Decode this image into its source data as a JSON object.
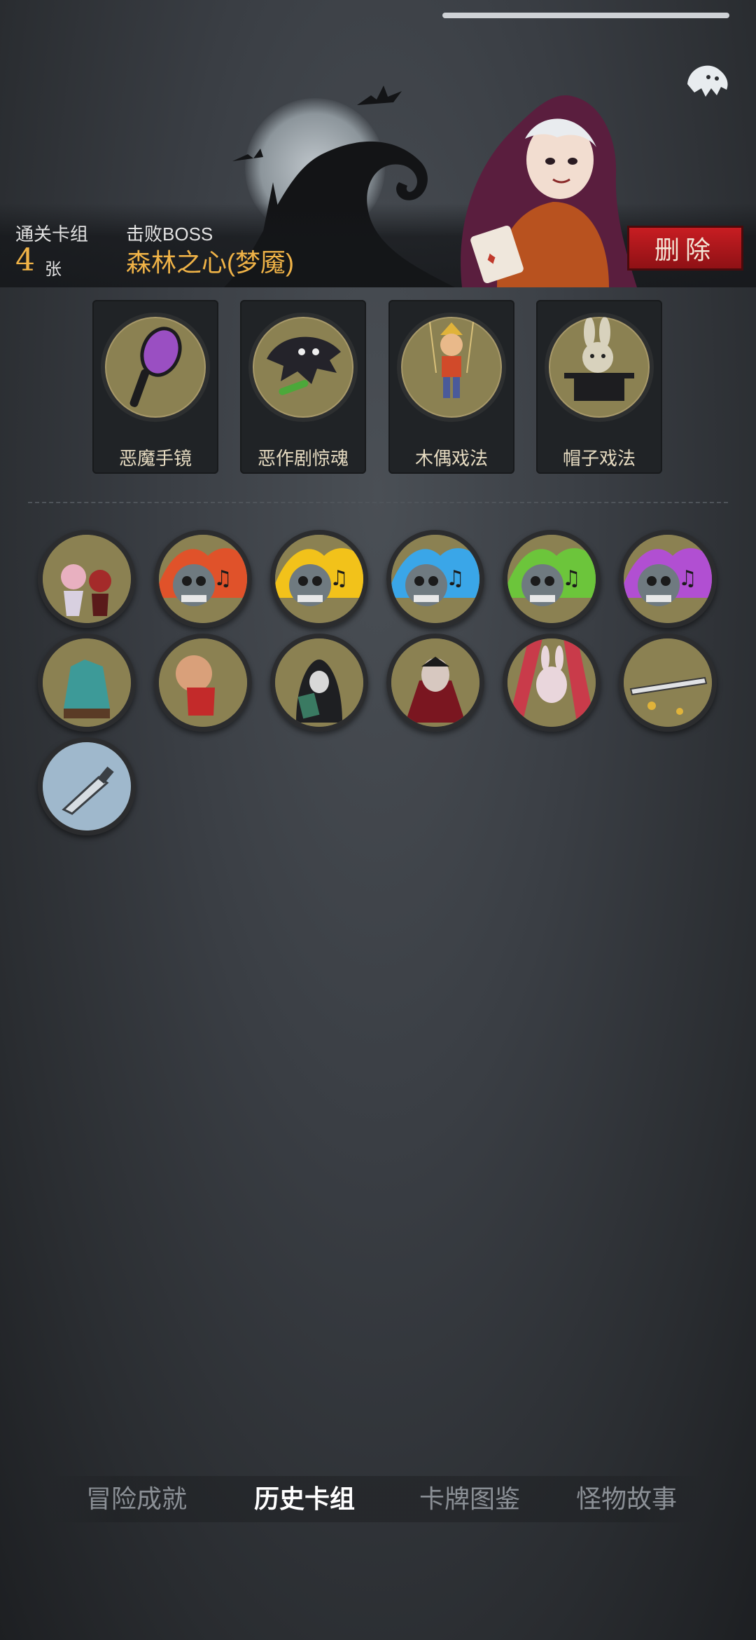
{
  "header": {
    "cleared_deck_label": "通关卡组",
    "card_count": "4",
    "card_unit": "张",
    "defeat_boss_label": "击败BOSS",
    "boss_name": "森林之心(梦魇)",
    "delete_label": "删除"
  },
  "relics": [
    {
      "name": "恶魔手镜",
      "icon": "demon-hand-mirror-icon"
    },
    {
      "name": "恶作剧惊魂",
      "icon": "prank-scare-icon"
    },
    {
      "name": "木偶戏法",
      "icon": "puppet-trick-icon"
    },
    {
      "name": "帽子戏法",
      "icon": "hat-trick-icon"
    }
  ],
  "cards": [
    {
      "icon": "girls-duo-card"
    },
    {
      "icon": "skull-music-red-card",
      "accent": "#e0522a"
    },
    {
      "icon": "skull-music-yellow-card",
      "accent": "#f2c21a"
    },
    {
      "icon": "skull-music-blue-card",
      "accent": "#3aa6e8"
    },
    {
      "icon": "skull-music-green-card",
      "accent": "#6cc53b"
    },
    {
      "icon": "skull-music-purple-card",
      "accent": "#b14fd2"
    },
    {
      "icon": "teal-gargoyle-card"
    },
    {
      "icon": "bloody-hands-card"
    },
    {
      "icon": "hooded-card-player-card"
    },
    {
      "icon": "vampire-card"
    },
    {
      "icon": "clown-rabbit-card"
    },
    {
      "icon": "golden-blade-card"
    },
    {
      "icon": "dagger-card"
    }
  ],
  "nav": {
    "tabs": [
      {
        "label": "冒险成就",
        "active": false
      },
      {
        "label": "历史卡组",
        "active": true
      },
      {
        "label": "卡牌图鉴",
        "active": false
      },
      {
        "label": "怪物故事",
        "active": false
      }
    ]
  },
  "colors": {
    "gold": "#f0b347",
    "delete_red": "#c71d22"
  }
}
